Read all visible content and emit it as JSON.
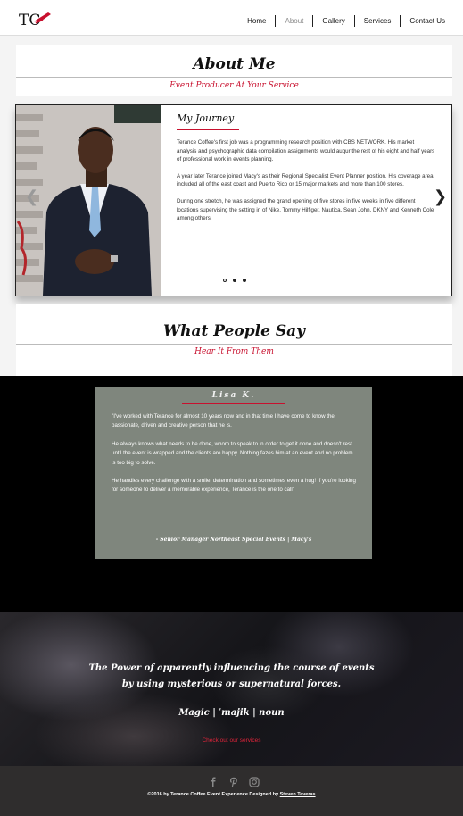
{
  "header": {
    "logo_text": "TC",
    "nav": [
      {
        "label": "Home",
        "active": false
      },
      {
        "label": "About",
        "active": true
      },
      {
        "label": "Gallery",
        "active": false
      },
      {
        "label": "Services",
        "active": false
      },
      {
        "label": "Contact Us",
        "active": false
      }
    ]
  },
  "about": {
    "title": "About Me",
    "subtitle": "Event Producer At Your Service"
  },
  "journey": {
    "heading": "My Journey",
    "paragraphs": [
      "Terance Coffee's first job was a programming research position with CBS NETWORK. His market analysis and psychographic data compilation assignments would augur the rest of his eight and half years of professional work in events planning.",
      "A year later Terance joined Macy's as their Regional Specialist Event Planner position. His coverage area included all of the east coast and Puerto Rico or 15 major markets and more than 100 stores.",
      "During one stretch, he was assigned the grand opening of five stores in five weeks in five different locations supervising the setting in of Nike, Tommy Hilfiger, Nautica, Sean John, DKNY and Kenneth Cole among others."
    ],
    "slide_count": 3,
    "active_slide": 0
  },
  "testimonials_header": {
    "title": "What People Say",
    "subtitle": "Hear It From Them"
  },
  "testimonial": {
    "name": "Lisa K.",
    "paragraphs": [
      "\"I've worked with Terance for almost 10 years now and in that time I have come to know the passionate, driven and creative person that he is.",
      "He always knows what needs to be done, whom to speak to in order to get it done and doesn't rest until the event is wrapped and the clients are happy. Nothing fazes him at an event and no problem is too big to solve.",
      "He handles every challenge with a smile, determination and sometimes even a hug! If you're looking for someone to deliver a memorable experience, Terance is the one to call\""
    ],
    "signature": "- Senior Manager Northeast Special Events | Macy's"
  },
  "hero": {
    "quote_line1": "The Power of apparently influencing the course of events",
    "quote_line2": "by using mysterious or supernatural forces.",
    "definition": "Magic | ˈmajik | noun",
    "link": "Check out our services"
  },
  "footer": {
    "social": [
      "facebook-icon",
      "pinterest-icon",
      "instagram-icon"
    ],
    "copyright_prefix": "©2016 by Terance Coffee Event Experience Designed by ",
    "designer": "Steven Taveras"
  },
  "colors": {
    "accent_red": "#c8102e",
    "card_bg": "#7f867d",
    "footer_bg": "#2f2d2d"
  }
}
